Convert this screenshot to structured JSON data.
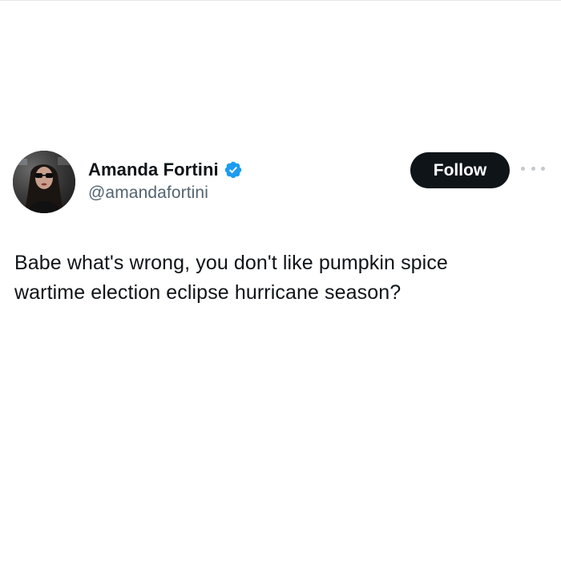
{
  "tweet": {
    "author": {
      "display_name": "Amanda Fortini",
      "handle": "@amandafortini",
      "verified": true
    },
    "follow_label": "Follow",
    "text_lines": [
      "Babe what's wrong, you don't like pumpkin spice",
      "wartime election eclipse hurricane season?"
    ]
  },
  "icons": {
    "verified": "verified-badge-icon",
    "more": "more-options-icon"
  },
  "colors": {
    "verified_blue": "#1d9bf0",
    "follow_bg": "#0f1419",
    "handle_gray": "#536471"
  }
}
